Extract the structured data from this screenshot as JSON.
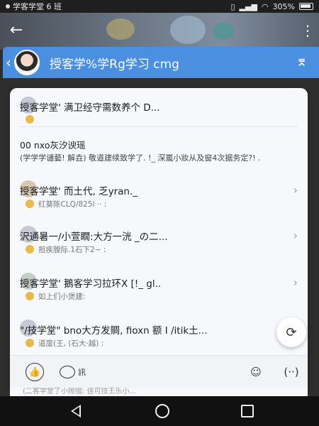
{
  "status_bar": {
    "left_text": "学客学堂 6 班",
    "battery": "305%"
  },
  "header": {
    "title": "授客学%学Rg学习 cmg",
    "back_icon": "arrow-left-icon",
    "more_icon": "more-vertical-icon",
    "action_icon": "collapse-icon"
  },
  "feed": [
    {
      "title": "授客学堂' 满卫经守需数养个 D...",
      "subtitle": "",
      "has_avatar": true,
      "has_chevron": false
    },
    {
      "title": "00 nxo灰汐谀瑶",
      "subtitle": "(学学学谴藝! 解垚) 敬道建续致学了. !_ 深嵐小妝从及窗4次据务定?! .",
      "has_avatar": false,
      "has_chevron": false
    },
    {
      "title": "授客学堂' 而土代, 乏yran._",
      "subtitle": "红葵陈CLQ/825l ·· :",
      "has_avatar": true,
      "has_chevron": true
    },
    {
      "title": "沢通暑一/小萱瞯:大方一洸 _の二...",
      "subtitle": "担疾膛际.1石下2~ :",
      "has_avatar": true,
      "has_chevron": true
    },
    {
      "title": "授客学堂' 鵝客学习拉环X [!_ gl..",
      "subtitle": "如上们小煲建:",
      "has_avatar": true,
      "has_chevron": true
    },
    {
      "title": "\"/技学堂\" bno大方发賙, fioxn 额 I /itik土...",
      "subtitle": "道度(王, (石大·越) :",
      "has_avatar": true,
      "has_chevron": false
    }
  ],
  "actions": {
    "like_icon": "thumbs-up-icon",
    "comment_icon": "comment-icon",
    "comment_label": "訊",
    "emoji_icon": "emoji-icon",
    "more_icon": "more-horizontal-icon",
    "refresh_icon": "refresh-icon"
  },
  "peek_text": "(二客学堂了小隙摺: 佳可技王乐小..."
}
